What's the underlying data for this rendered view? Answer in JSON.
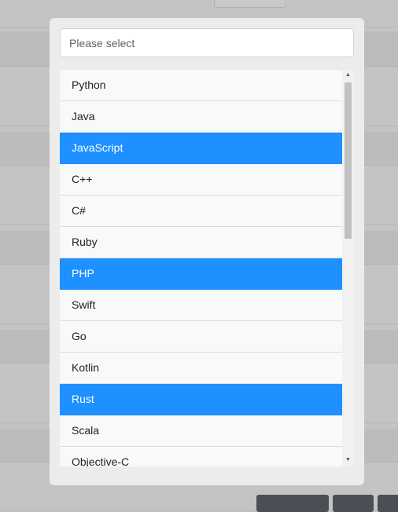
{
  "select": {
    "placeholder": "Please select"
  },
  "options": [
    {
      "label": "Python",
      "selected": false
    },
    {
      "label": "Java",
      "selected": false
    },
    {
      "label": "JavaScript",
      "selected": true
    },
    {
      "label": "C++",
      "selected": false
    },
    {
      "label": "C#",
      "selected": false
    },
    {
      "label": "Ruby",
      "selected": false
    },
    {
      "label": "PHP",
      "selected": true
    },
    {
      "label": "Swift",
      "selected": false
    },
    {
      "label": "Go",
      "selected": false
    },
    {
      "label": "Kotlin",
      "selected": false
    },
    {
      "label": "Rust",
      "selected": true
    },
    {
      "label": "Scala",
      "selected": false
    },
    {
      "label": "Objective-C",
      "selected": false
    }
  ],
  "scrollbar": {
    "up_icon": "triangle-up-icon",
    "down_icon": "triangle-down-icon"
  },
  "colors": {
    "selected_bg": "#1e90ff",
    "option_bg": "#f8f9fa",
    "modal_bg": "#ececec"
  }
}
